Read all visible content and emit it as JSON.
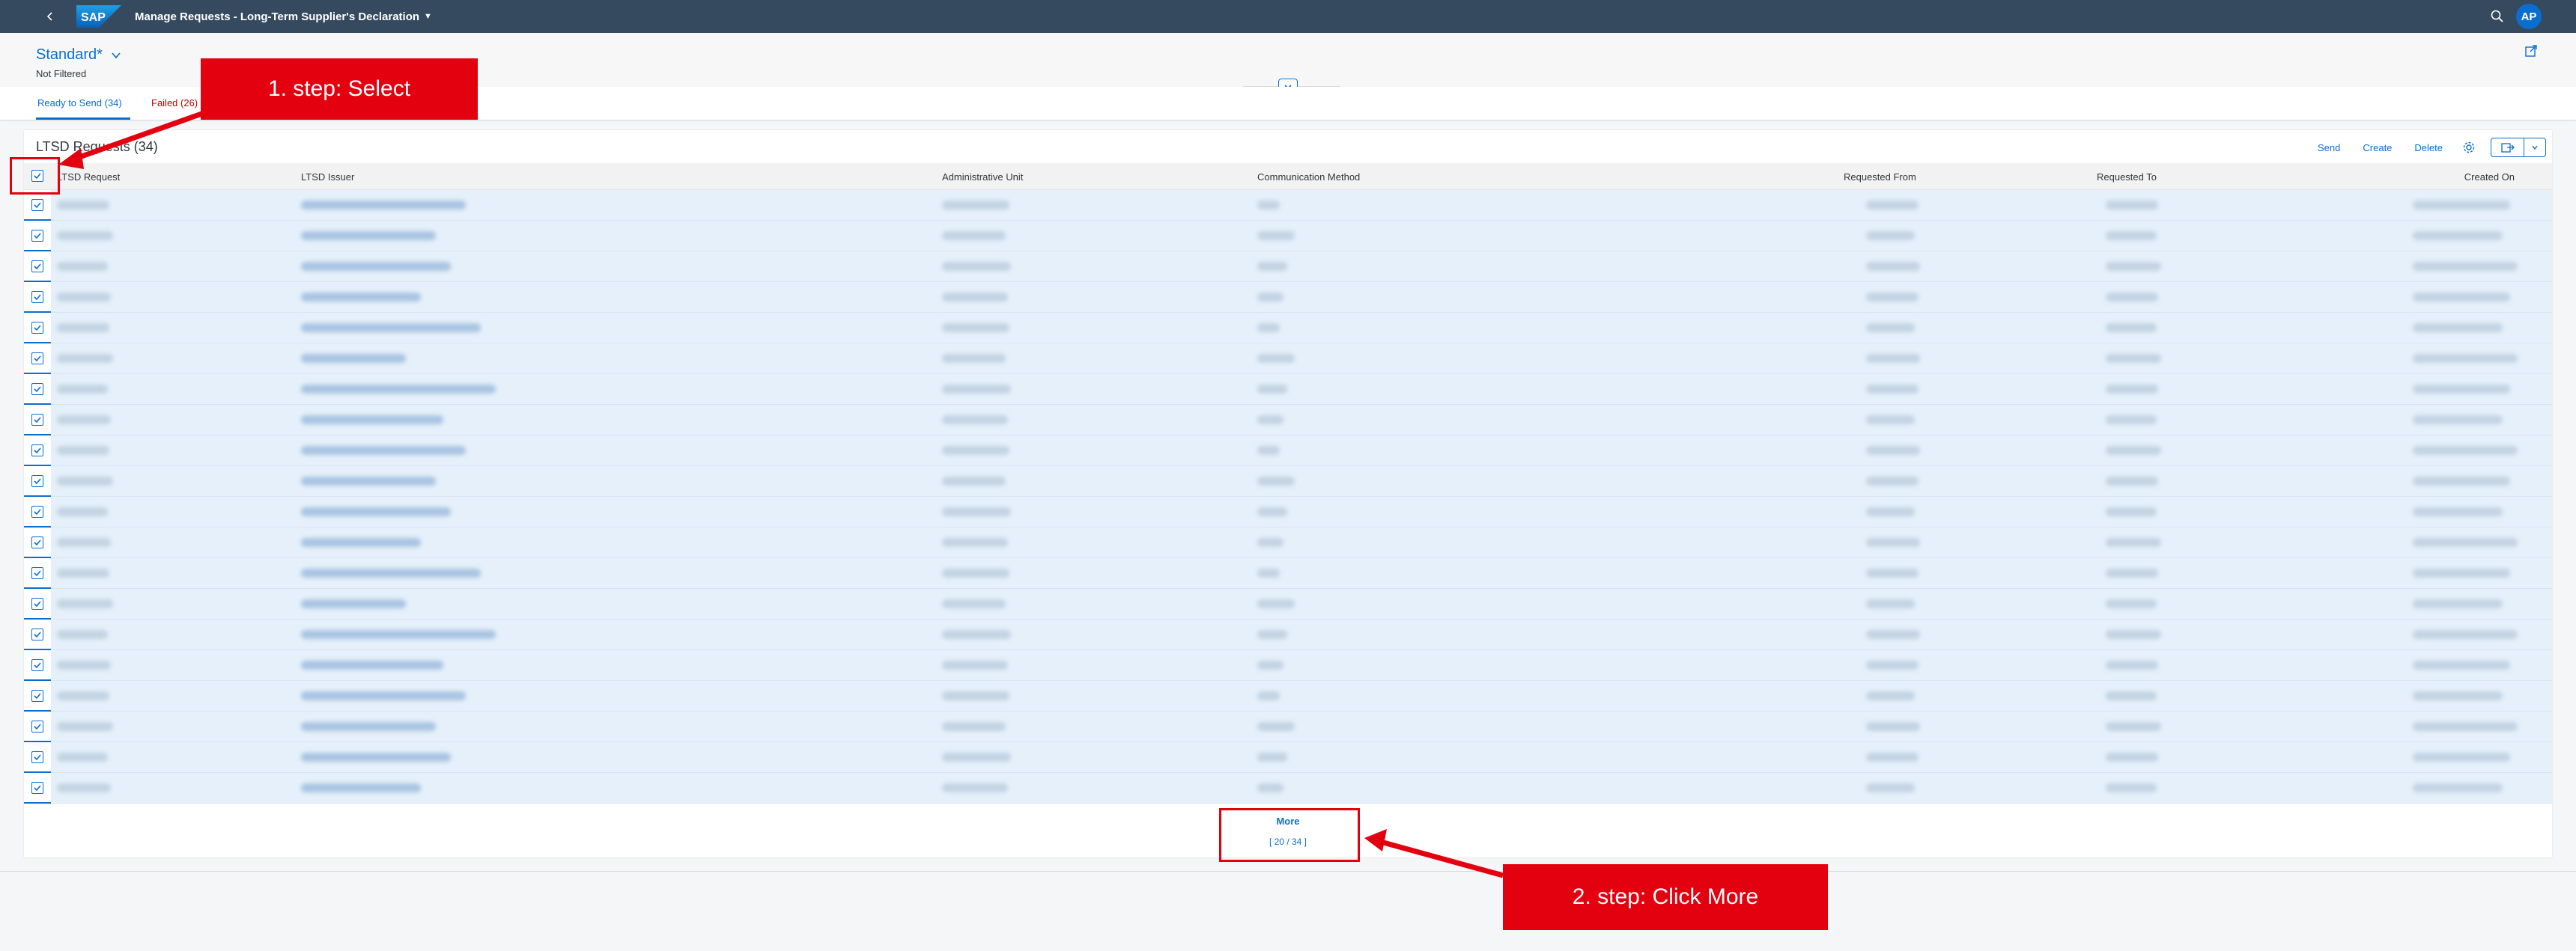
{
  "shell": {
    "title": "Manage Requests - Long-Term Supplier's Declaration",
    "avatar_initials": "AP",
    "logo_text": "SAP",
    "brand_color": "#354a5f"
  },
  "header": {
    "variant": "Standard*",
    "filter_status": "Not Filtered"
  },
  "tabs": [
    {
      "label": "Ready to Send (34)",
      "selected": true
    },
    {
      "label": "Failed (26)",
      "selected": false,
      "status_color": "#bb0000"
    }
  ],
  "table": {
    "title": "LTSD Requests (34)",
    "toolbar": {
      "send": "Send",
      "create": "Create",
      "delete": "Delete"
    },
    "columns": [
      "LTSD Request",
      "LTSD Issuer",
      "Administrative Unit",
      "Communication Method",
      "Requested From",
      "Requested To",
      "Created On"
    ],
    "visible_rows": 20,
    "all_selected": true,
    "more": {
      "label": "More",
      "count": "[ 20 / 34 ]"
    }
  },
  "annotations": {
    "step1": "1. step: Select",
    "step2": "2. step: Click More",
    "color": "#e3000f"
  },
  "icons": [
    "back-icon",
    "search-icon",
    "share-icon",
    "chevron-down-icon",
    "gear-icon",
    "export-icon"
  ]
}
